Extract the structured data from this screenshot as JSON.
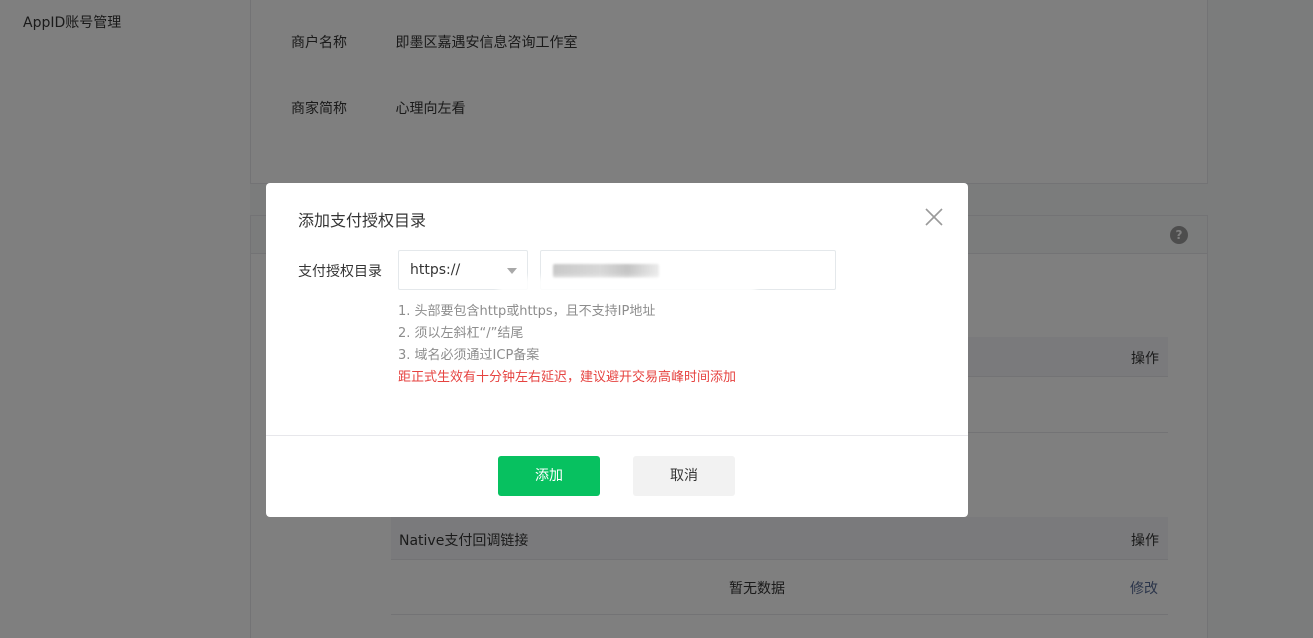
{
  "sidebar": {
    "items": [
      {
        "label": "AppID账号管理"
      }
    ]
  },
  "merchant": {
    "name_label": "商户名称",
    "name_value": "即墨区嘉遇安信息咨询工作室",
    "short_label": "商家简称",
    "short_value": "心理向左看"
  },
  "table_a": {
    "op_header": "操作"
  },
  "table_b": {
    "name_header": "Native支付回调链接",
    "op_header": "操作",
    "empty_text": "暂无数据",
    "edit_label": "修改"
  },
  "help_icon": {
    "glyph": "?"
  },
  "dialog": {
    "title": "添加支付授权目录",
    "field_label": "支付授权目录",
    "protocol_select": {
      "selected": "https://"
    },
    "url_input": {
      "value": ""
    },
    "tips": [
      "1. 头部要包含http或https，且不支持IP地址",
      "2. 须以左斜杠“/”结尾",
      "3. 域名必须通过ICP备案"
    ],
    "warning": "距正式生效有十分钟左右延迟，建议避开交易高峰时间添加",
    "confirm_label": "添加",
    "cancel_label": "取消"
  },
  "colors": {
    "primary": "#07c160",
    "warning": "#e64340",
    "link": "#576b95",
    "mask": "rgba(0,0,0,0.5)"
  },
  "icons": {
    "close": "close-icon",
    "help": "help-icon",
    "select_caret": "caret-down-icon"
  }
}
